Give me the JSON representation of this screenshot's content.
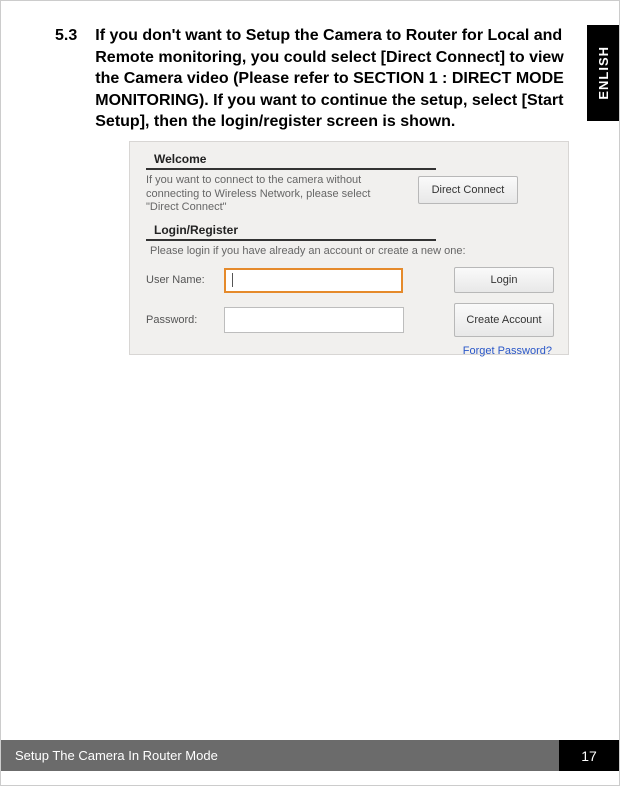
{
  "lang_tab": "ENLISH",
  "section": {
    "number": "5.3",
    "text": "If you don't want to Setup the Camera to Router for Local and Remote monitoring, you could select [Direct Connect] to view the Camera video (Please refer to SECTION 1 : DIRECT MODE MONITORING).    If you want to continue the setup, select [Start Setup],  then the login/register screen is shown."
  },
  "screenshot": {
    "welcome_header": "Welcome",
    "welcome_text": "If you want to connect to the camera without connecting to Wireless Network, please select \"Direct Connect\"",
    "direct_connect_label": "Direct Connect",
    "login_header": "Login/Register",
    "login_note": "Please login if you have already an account or create a new one:",
    "username_label": "User Name:",
    "username_value": "",
    "password_label": "Password:",
    "password_value": "",
    "login_button": "Login",
    "create_account_button": "Create Account",
    "forgot_link": "Forget Password?"
  },
  "footer": {
    "title": "Setup The Camera In Router Mode",
    "page": "17"
  }
}
